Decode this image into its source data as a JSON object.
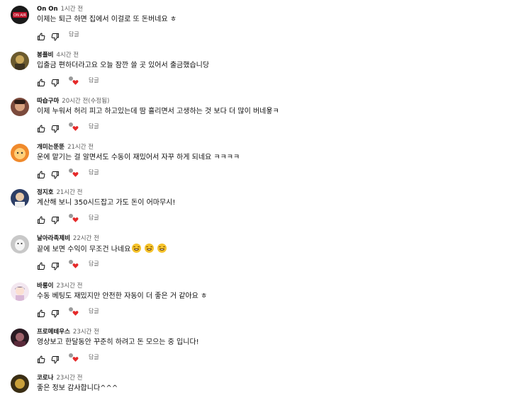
{
  "comments": [
    {
      "author": "On On",
      "time": "1시간 전",
      "text": "이제는 퇴근 하면 집에서 이걸로 또 돈버네요 ㅎ",
      "reply_label": "답글",
      "hearted": false,
      "avatar_text": "ON AIR",
      "emoji_count": 0
    },
    {
      "author": "봉플비",
      "time": "4시간 전",
      "text": "입출금 편하더라고요 오늘 잠깐 쓸 곳 있어서 출금했습니당",
      "reply_label": "답글",
      "hearted": true,
      "emoji_count": 0
    },
    {
      "author": "따습구마",
      "time": "20시간 전(수정됨)",
      "text": "이제 누워서 허리 피고 하고있는데 땀 흘리면서 고생하는 것 보다 더 많이 버네욯ㅋ",
      "reply_label": "답글",
      "hearted": true,
      "emoji_count": 0
    },
    {
      "author": "개미는뚠뚠",
      "time": "21시간 전",
      "text": "운에 맡기는 걸 알면서도 수동이 재밌어서 자꾸 하게 되네요 ㅋㅋㅋㅋ",
      "reply_label": "답글",
      "hearted": true,
      "emoji_count": 0
    },
    {
      "author": "정지호",
      "time": "21시간 전",
      "text": "계산해 보니 350시드잡고 가도 돈이 어마무시!",
      "reply_label": "답글",
      "hearted": true,
      "emoji_count": 0
    },
    {
      "author": "날아라족제비",
      "time": "22시간 전",
      "text": "끝에 보면 수익이 무조건 나네요",
      "reply_label": "답글",
      "hearted": true,
      "emoji_count": 3
    },
    {
      "author": "바룽이",
      "time": "23시간 전",
      "text": "수동 베팅도 재밌지만 안전한 자동이 더 좋은 거 같아요 ㅎ",
      "reply_label": "답글",
      "hearted": true,
      "emoji_count": 0
    },
    {
      "author": "프로메테우스",
      "time": "23시간 전",
      "text": "영상보고 한달동안 꾸준히 하려고 돈 모으는 중 입니다!",
      "reply_label": "답글",
      "hearted": true,
      "emoji_count": 0
    },
    {
      "author": "코로나",
      "time": "23시간 전",
      "text": "좋은 정보 감사합니다^^^",
      "reply_label": "",
      "hearted": false,
      "emoji_count": 0
    }
  ],
  "colors": {
    "heart": "#e52929",
    "secondary_text": "#606060",
    "icon": "#0f0f0f"
  },
  "icons": {
    "like": "thumbs-up-icon",
    "dislike": "thumbs-down-icon",
    "heart": "creator-heart-icon"
  }
}
